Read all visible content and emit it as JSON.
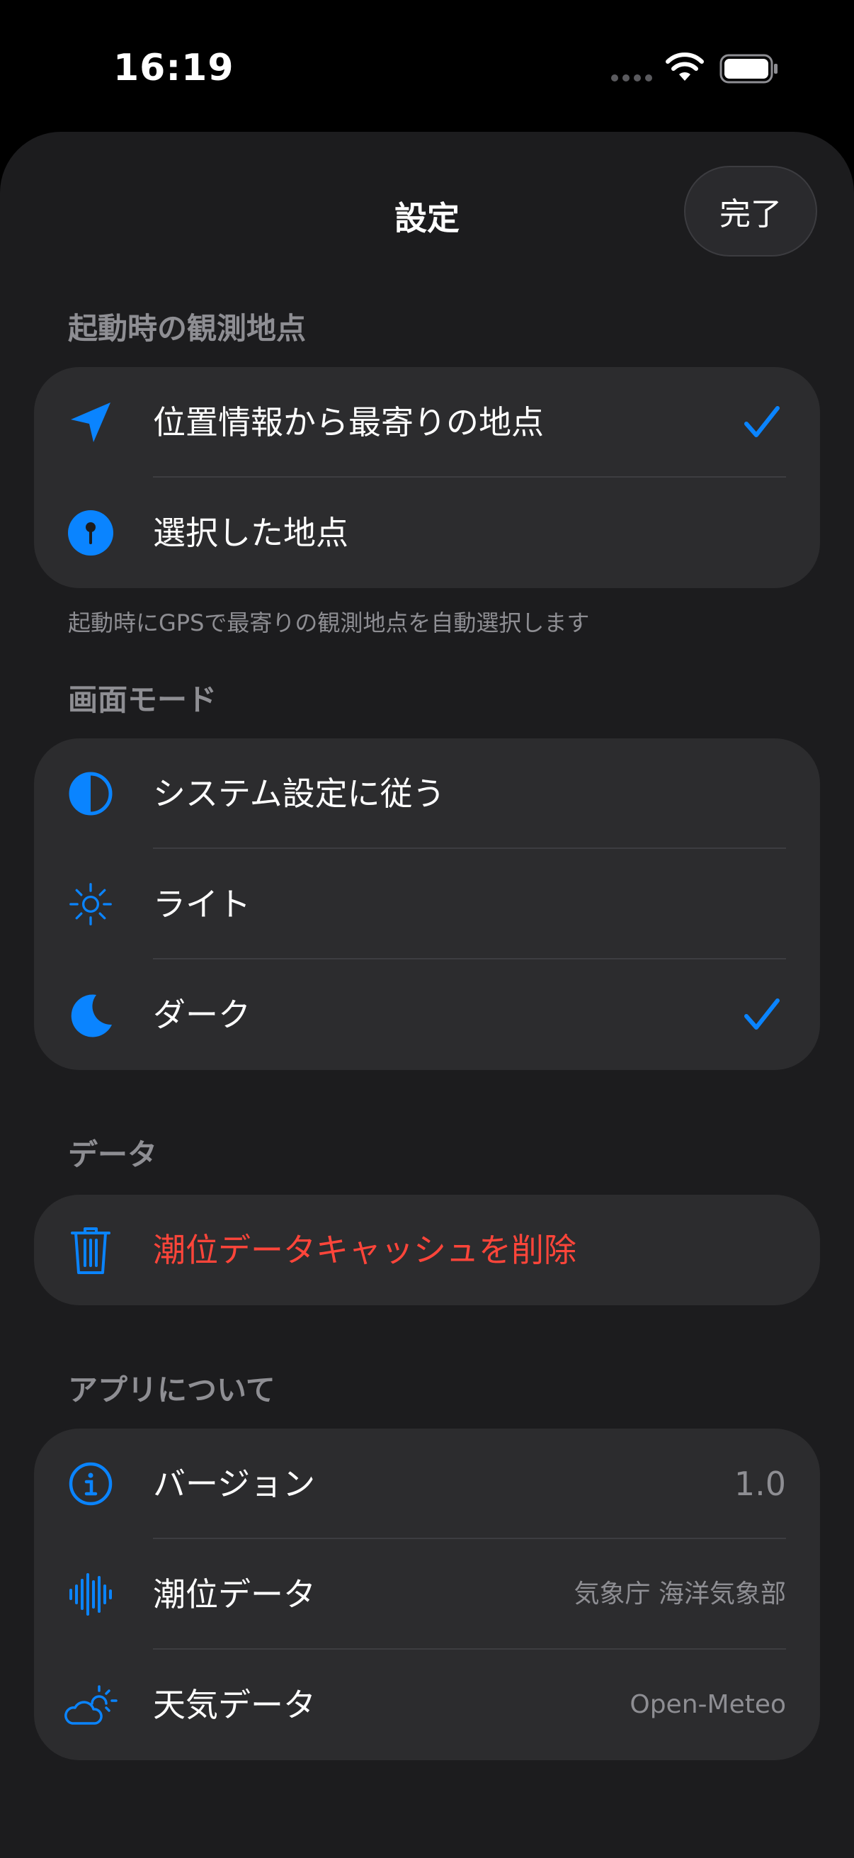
{
  "status_bar": {
    "time": "16:19"
  },
  "nav": {
    "title": "設定",
    "done_label": "完了"
  },
  "sections": {
    "startup": {
      "header": "起動時の観測地点",
      "items": [
        {
          "label": "位置情報から最寄りの地点",
          "checked": true
        },
        {
          "label": "選択した地点",
          "checked": false
        }
      ],
      "footer": "起動時にGPSで最寄りの観測地点を自動選択します"
    },
    "display": {
      "header": "画面モード",
      "items": [
        {
          "label": "システム設定に従う",
          "checked": false
        },
        {
          "label": "ライト",
          "checked": false
        },
        {
          "label": "ダーク",
          "checked": true
        }
      ]
    },
    "data": {
      "header": "データ",
      "items": [
        {
          "label": "潮位データキャッシュを削除"
        }
      ]
    },
    "about": {
      "header": "アプリについて",
      "items": [
        {
          "label": "バージョン",
          "value": "1.0"
        },
        {
          "label": "潮位データ",
          "value": "気象庁 海洋気象部"
        },
        {
          "label": "天気データ",
          "value": "Open-Meteo"
        }
      ]
    }
  },
  "icons": {
    "location": "location-arrow-icon",
    "pin": "map-pin-icon",
    "system": "half-circle-icon",
    "light": "sun-icon",
    "dark": "moon-icon",
    "trash": "trash-icon",
    "info": "info-icon",
    "waveform": "waveform-icon",
    "weather": "cloud-sun-icon"
  },
  "colors": {
    "accent": "#0a84ff",
    "destructive": "#ff453a",
    "background": "#1c1c1e",
    "card": "#2c2c2e",
    "secondary_text": "#8e8e93"
  }
}
